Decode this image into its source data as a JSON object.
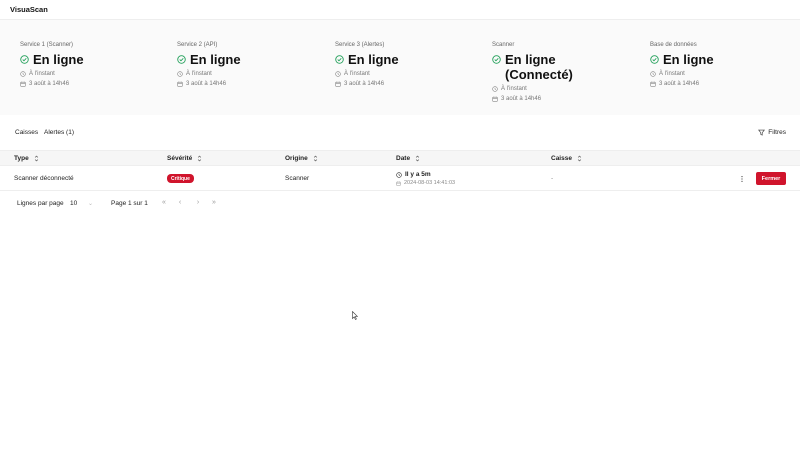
{
  "app": {
    "title": "VisuaScan"
  },
  "services": [
    {
      "name": "Service 1 (Scanner)",
      "status": "En ligne",
      "last_check": "À l'instant",
      "date": "3 août à 14h46"
    },
    {
      "name": "Service 2 (API)",
      "status": "En ligne",
      "last_check": "À l'instant",
      "date": "3 août à 14h46"
    },
    {
      "name": "Service 3 (Alertes)",
      "status": "En ligne",
      "last_check": "À l'instant",
      "date": "3 août à 14h46"
    },
    {
      "name": "Scanner",
      "status": "En ligne (Connecté)",
      "last_check": "À l'instant",
      "date": "3 août à 14h46"
    },
    {
      "name": "Base de données",
      "status": "En ligne",
      "last_check": "À l'instant",
      "date": "3 août à 14h46"
    }
  ],
  "tabs": [
    {
      "label": "Caisses"
    },
    {
      "label": "Alertes (1)"
    }
  ],
  "filters": {
    "label": "Filtres"
  },
  "table": {
    "columns": [
      "Type",
      "Sévérité",
      "Origine",
      "Date",
      "Caisse"
    ],
    "rows": [
      {
        "type": "Scanner déconnecté",
        "severity": "Critique",
        "origin": "Scanner",
        "date_relative": "Il y a 5m",
        "date_absolute": "2024-08-03 14:41:03",
        "caisse": "-",
        "action": "Fermer"
      }
    ]
  },
  "pagination": {
    "rows_per_page_label": "Lignes par page",
    "rows_per_page": "10",
    "page_info": "Page 1 sur 1",
    "first": "«",
    "prev": "‹",
    "next": "›",
    "last": "»"
  },
  "colors": {
    "accent_red": "#d0142c",
    "ok_green": "#22a05a"
  },
  "icons": {
    "status": "check-circle-icon",
    "time": "clock-icon",
    "date": "calendar-icon",
    "sort": "sort-icon",
    "filter": "filter-icon",
    "more": "more-vertical-icon"
  }
}
